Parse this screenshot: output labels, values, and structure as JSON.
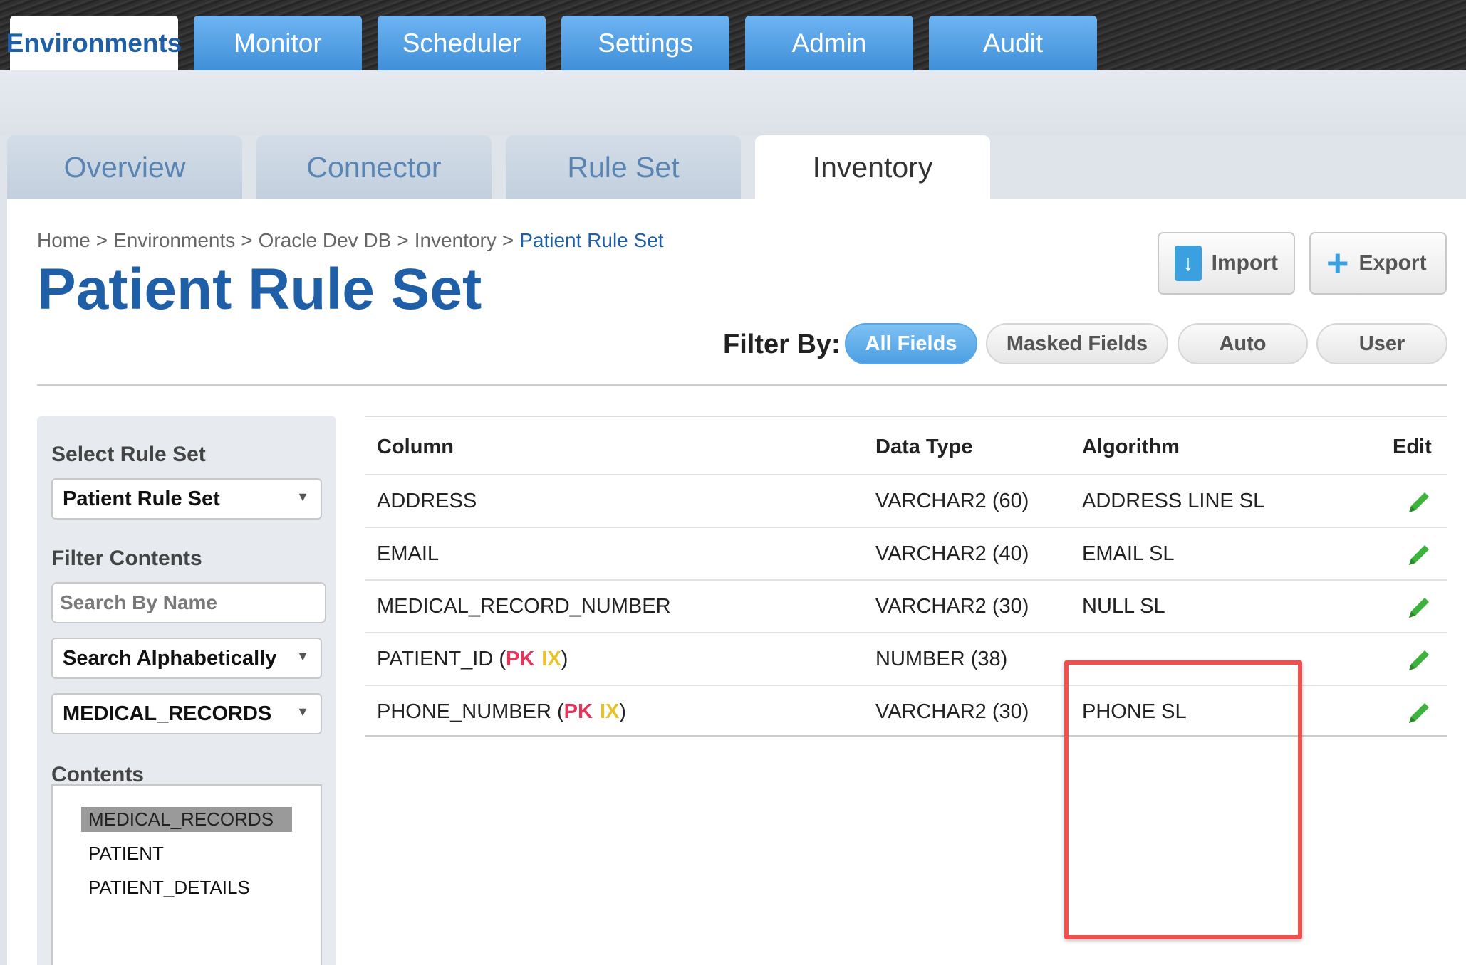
{
  "top_nav": {
    "tabs": [
      "Environments",
      "Monitor",
      "Scheduler",
      "Settings",
      "Admin",
      "Audit"
    ],
    "active": "Environments"
  },
  "sub_tabs": {
    "tabs": [
      "Overview",
      "Connector",
      "Rule Set",
      "Inventory"
    ],
    "active": "Inventory"
  },
  "breadcrumb": {
    "items": [
      "Home",
      ">",
      "Environments",
      ">",
      "Oracle Dev DB",
      ">",
      "Inventory",
      ">"
    ],
    "current": "Patient Rule Set"
  },
  "page_title": "Patient Rule Set",
  "toolbar": {
    "import_label": "Import",
    "export_label": "Export"
  },
  "filter": {
    "label": "Filter By:",
    "options": [
      "All Fields",
      "Masked Fields",
      "Auto",
      "User"
    ],
    "active": "All Fields"
  },
  "sidebar": {
    "select_rule_set_label": "Select Rule Set",
    "rule_set_value": "Patient Rule Set",
    "filter_contents_label": "Filter Contents",
    "search_placeholder": "Search By Name",
    "sort_value": "Search Alphabetically",
    "table_value": "MEDICAL_RECORDS",
    "contents_label": "Contents",
    "contents": [
      "MEDICAL_RECORDS",
      "PATIENT",
      "PATIENT_DETAILS"
    ],
    "selected_content": "MEDICAL_RECORDS"
  },
  "table": {
    "headers": {
      "column": "Column",
      "data_type": "Data Type",
      "algorithm": "Algorithm",
      "edit": "Edit"
    },
    "rows": [
      {
        "column": "ADDRESS",
        "pk": "",
        "ix": "",
        "data_type": "VARCHAR2 (60)",
        "algorithm": "ADDRESS LINE SL"
      },
      {
        "column": "EMAIL",
        "pk": "",
        "ix": "",
        "data_type": "VARCHAR2 (40)",
        "algorithm": "EMAIL SL"
      },
      {
        "column": "MEDICAL_RECORD_NUMBER",
        "pk": "",
        "ix": "",
        "data_type": "VARCHAR2 (30)",
        "algorithm": "NULL SL"
      },
      {
        "column": "PATIENT_ID (",
        "pk": "PK",
        "ix": "IX",
        "close": ")",
        "data_type": "NUMBER (38)",
        "algorithm": ""
      },
      {
        "column": "PHONE_NUMBER (",
        "pk": "PK",
        "ix": "IX",
        "close": ")",
        "data_type": "VARCHAR2 (30)",
        "algorithm": "PHONE SL"
      }
    ]
  },
  "colors": {
    "brand_blue": "#1e5fa8",
    "tab_blue": "#4c9fe3",
    "pk": "#e8345a",
    "ix": "#e8c22a",
    "highlight": "#ef5050",
    "edit_icon": "#3cb43c"
  },
  "icons": {
    "import": "download-icon",
    "export": "plus-icon",
    "edit": "pencil-icon",
    "dropdown": "triangle-down-icon"
  }
}
